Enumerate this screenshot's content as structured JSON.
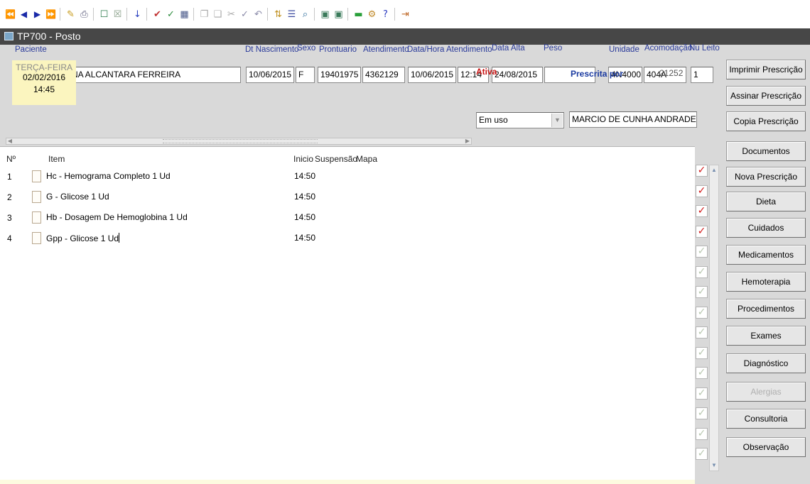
{
  "toolbar": {
    "icons": [
      "first-record-icon",
      "previous-record-icon",
      "next-record-icon",
      "last-record-icon",
      "edit-icon",
      "print-icon",
      "new-record-icon",
      "delete-record-icon",
      "save-icon",
      "accept-icon",
      "reject-icon",
      "grid-icon",
      "copy-icon",
      "paste-icon",
      "cut-icon",
      "clear-icon",
      "undo-icon",
      "sort-icon",
      "list-icon",
      "search-icon",
      "export-icon",
      "import-icon",
      "note-icon",
      "tools-icon",
      "help-icon",
      "exit-icon"
    ]
  },
  "window": {
    "title": "TP700 - Posto"
  },
  "labels": {
    "paciente": "Paciente",
    "dt_nascimento": "Dt Nascimento",
    "sexo": "Sexo",
    "prontuario": "Prontuario",
    "atendimento": "Atendimento",
    "data_hora_atendimento": "Data/Hora Atendimento",
    "data_alta": "Data Alta",
    "peso": "Peso",
    "unidade": "Unidade",
    "acomodacao": "Acomodação",
    "nu_leito": "Nu Leito"
  },
  "fields": {
    "paciente": "RN DE CRISTINA ALCANTARA FERREIRA",
    "dt_nascimento": "10/06/2015",
    "sexo": "F",
    "prontuario": "19401975",
    "atendimento": "4362129",
    "data_atendimento": "10/06/2015",
    "hora_atendimento": "12:14",
    "data_alta": "24/08/2015",
    "peso": "",
    "unidade": "4N4000",
    "acomodacao": "404A",
    "nu_leito": "1"
  },
  "date_box": {
    "weekday": "TERÇA-FEIRA",
    "date": "02/02/2016",
    "time": "14:45"
  },
  "status": {
    "label": "Ativa",
    "value": "Em uso"
  },
  "prescriber": {
    "label": "Prescrita por",
    "code": "21252",
    "name": "MARCIO DE CUNHA ANDRADE"
  },
  "grid": {
    "headers": {
      "num": "Nº",
      "item": "Item",
      "inicio": "Inicio",
      "suspensao": "Suspensão",
      "mapa": "Mapa"
    },
    "rows": [
      {
        "num": "1",
        "item": "Hc - Hemograma Completo 1 Ud",
        "inicio": "14:50"
      },
      {
        "num": "2",
        "item": "G - Glicose 1 Ud",
        "inicio": "14:50"
      },
      {
        "num": "3",
        "item": "Hb - Dosagem De Hemoglobina 1 Ud",
        "inicio": "14:50"
      },
      {
        "num": "4",
        "item": "Gpp - Glicose 1 Ud",
        "inicio": "14:50"
      }
    ],
    "checks": [
      true,
      true,
      true,
      true,
      false,
      false,
      false,
      false,
      false,
      false,
      false,
      false,
      false,
      false,
      false
    ]
  },
  "side_buttons": [
    "Imprimir Prescrição",
    "Assinar Prescrição",
    "Copia Prescrição",
    "Documentos",
    "Nova Prescrição",
    "Dieta",
    "Cuidados",
    "Medicamentos",
    "Hemoterapia",
    "Procedimentos",
    "Exames",
    "Diagnóstico",
    "Alergias",
    "Consultoria",
    "Observação"
  ],
  "colors": {
    "title_bar": "#474747",
    "label_blue": "#2a3a9a",
    "ativa_red": "#c81414",
    "check_red": "#d11a1a",
    "date_box": "#fbf5bf"
  }
}
